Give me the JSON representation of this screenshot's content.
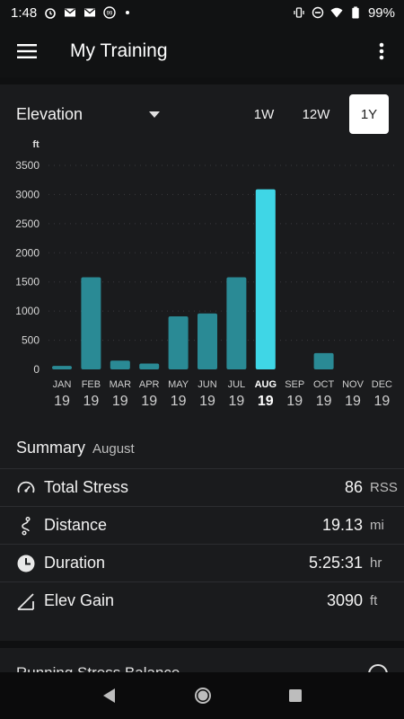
{
  "status": {
    "time": "1:48",
    "battery": "99%"
  },
  "appbar": {
    "title": "My Training"
  },
  "metric": {
    "label": "Elevation"
  },
  "ranges": [
    "1W",
    "12W",
    "1Y"
  ],
  "active_range": "1Y",
  "chart_data": {
    "type": "bar",
    "unit_label": "ft",
    "categories": [
      "JAN",
      "FEB",
      "MAR",
      "APR",
      "MAY",
      "JUN",
      "JUL",
      "AUG",
      "SEP",
      "OCT",
      "NOV",
      "DEC"
    ],
    "years": [
      "19",
      "19",
      "19",
      "19",
      "19",
      "19",
      "19",
      "19",
      "19",
      "19",
      "19",
      "19"
    ],
    "values": [
      60,
      1580,
      150,
      100,
      910,
      960,
      1580,
      3090,
      0,
      280,
      0,
      0
    ],
    "highlight_index": 7,
    "ylim": [
      0,
      3500
    ],
    "yticks": [
      0,
      500,
      1000,
      1500,
      2000,
      2500,
      3000,
      3500
    ],
    "colors": {
      "bar": "#2a8a95",
      "highlight": "#3fd6e6"
    },
    "grid": true
  },
  "summary": {
    "title": "Summary",
    "period": "August",
    "rows": [
      {
        "icon": "gauge-icon",
        "label": "Total Stress",
        "value": "86",
        "unit": "RSS"
      },
      {
        "icon": "route-icon",
        "label": "Distance",
        "value": "19.13",
        "unit": "mi"
      },
      {
        "icon": "clock-icon",
        "label": "Duration",
        "value": "5:25:31",
        "unit": "hr"
      },
      {
        "icon": "elevation-icon",
        "label": "Elev Gain",
        "value": "3090",
        "unit": "ft"
      }
    ]
  },
  "next_card": {
    "title": "Running Stress Balance"
  }
}
